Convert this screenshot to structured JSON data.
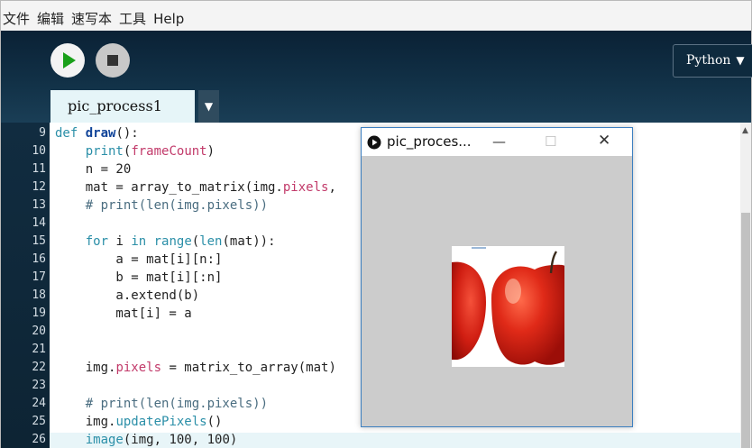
{
  "menu": [
    "文件",
    "编辑",
    "速写本",
    "工具",
    "Help"
  ],
  "toolbar": {
    "run_icon": "play-icon",
    "stop_icon": "stop-icon",
    "mode": "Python",
    "mode_arrow": "▼"
  },
  "tab": {
    "label": "pic_process1",
    "menu_arrow": "▼"
  },
  "gutter": [
    "9",
    "10",
    "11",
    "12",
    "13",
    "14",
    "15",
    "16",
    "17",
    "18",
    "19",
    "20",
    "21",
    "22",
    "23",
    "24",
    "25",
    "26"
  ],
  "code": [
    [
      {
        "t": "def",
        "c": "kw"
      },
      {
        "t": " "
      },
      {
        "t": "draw",
        "c": "def-name"
      },
      {
        "t": "():"
      }
    ],
    [
      {
        "t": "    "
      },
      {
        "t": "print",
        "c": "fn"
      },
      {
        "t": "("
      },
      {
        "t": "frameCount",
        "c": "attr"
      },
      {
        "t": ")"
      }
    ],
    [
      {
        "t": "    n = 20"
      }
    ],
    [
      {
        "t": "    mat = array_to_matrix(img."
      },
      {
        "t": "pixels",
        "c": "attr"
      },
      {
        "t": ","
      }
    ],
    [
      {
        "t": "    # print(len(img.pixels))",
        "c": "cm"
      }
    ],
    [
      {
        "t": ""
      }
    ],
    [
      {
        "t": "    "
      },
      {
        "t": "for",
        "c": "kw"
      },
      {
        "t": " i "
      },
      {
        "t": "in",
        "c": "kw"
      },
      {
        "t": " "
      },
      {
        "t": "range",
        "c": "fn"
      },
      {
        "t": "("
      },
      {
        "t": "len",
        "c": "fn"
      },
      {
        "t": "(mat)):"
      }
    ],
    [
      {
        "t": "        a = mat[i][n:]"
      }
    ],
    [
      {
        "t": "        b = mat[i][:n]"
      }
    ],
    [
      {
        "t": "        a.extend(b)"
      }
    ],
    [
      {
        "t": "        mat[i] = a"
      }
    ],
    [
      {
        "t": ""
      }
    ],
    [
      {
        "t": ""
      }
    ],
    [
      {
        "t": "    img."
      },
      {
        "t": "pixels",
        "c": "attr"
      },
      {
        "t": " = matrix_to_array(mat)"
      }
    ],
    [
      {
        "t": ""
      }
    ],
    [
      {
        "t": "    # print(len(img.pixels))",
        "c": "cm"
      }
    ],
    [
      {
        "t": "    img."
      },
      {
        "t": "updatePixels",
        "c": "fn"
      },
      {
        "t": "()"
      }
    ],
    [
      {
        "t": "    "
      },
      {
        "t": "image",
        "c": "fn"
      },
      {
        "t": "(img, 100, 100)"
      }
    ]
  ],
  "sketch_window": {
    "title": "pic_proces...",
    "icon": "processing-run-icon",
    "minimize": "—",
    "maximize": "☐",
    "close": "✕",
    "image": "apple-image"
  },
  "colors": {
    "toolbar_bg": "#123248",
    "tab_bg": "#e6f5f8",
    "canvas_bg": "#cccccc",
    "apple": "#d8261a"
  }
}
